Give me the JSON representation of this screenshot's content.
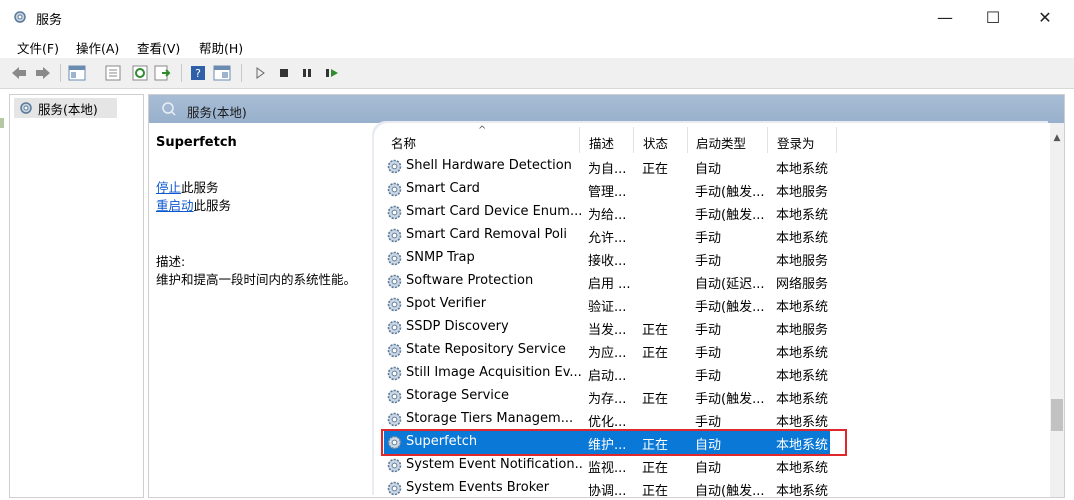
{
  "window": {
    "title": "服务",
    "icon": "services-gear-icon",
    "controls": {
      "minimize": "—",
      "maximize": "☐",
      "close": "✕"
    }
  },
  "menu": [
    "文件(F)",
    "操作(A)",
    "查看(V)",
    "帮助(H)"
  ],
  "toolbar": {
    "icons": [
      "back-icon",
      "forward-icon",
      "show-console-tree-icon",
      "properties-icon",
      "refresh-icon",
      "export-list-icon",
      "help-icon",
      "view-icon",
      "start-service-icon",
      "stop-service-icon",
      "pause-service-icon",
      "restart-service-icon"
    ]
  },
  "tree": {
    "root_label": "服务(本地)"
  },
  "pane": {
    "title": "服务(本地)",
    "selected_service": "Superfetch",
    "stop_link": "停止",
    "stop_suffix": "此服务",
    "restart_link": "重启动",
    "restart_suffix": "此服务",
    "desc_label": "描述:",
    "desc_text": "维护和提高一段时间内的系统性能。"
  },
  "table": {
    "columns": [
      "名称",
      "描述",
      "状态",
      "启动类型",
      "登录为"
    ],
    "rows": [
      {
        "name": "Shell Hardware Detection",
        "desc": "为自...",
        "status": "正在",
        "startup": "自动",
        "logon": "本地系统"
      },
      {
        "name": "Smart Card",
        "desc": "管理...",
        "status": "",
        "startup": "手动(触发...",
        "logon": "本地服务"
      },
      {
        "name": "Smart Card Device Enum...",
        "desc": "为给...",
        "status": "",
        "startup": "手动(触发...",
        "logon": "本地系统"
      },
      {
        "name": "Smart Card Removal Poli",
        "desc": "允许...",
        "status": "",
        "startup": "手动",
        "logon": "本地系统"
      },
      {
        "name": "SNMP Trap",
        "desc": "接收...",
        "status": "",
        "startup": "手动",
        "logon": "本地服务"
      },
      {
        "name": "Software Protection",
        "desc": "启用 ...",
        "status": "",
        "startup": "自动(延迟...",
        "logon": "网络服务"
      },
      {
        "name": "Spot Verifier",
        "desc": "验证...",
        "status": "",
        "startup": "手动(触发...",
        "logon": "本地系统"
      },
      {
        "name": "SSDP Discovery",
        "desc": "当发...",
        "status": "正在",
        "startup": "手动",
        "logon": "本地服务"
      },
      {
        "name": "State Repository Service",
        "desc": "为应...",
        "status": "正在",
        "startup": "手动",
        "logon": "本地系统"
      },
      {
        "name": "Still Image Acquisition Ev...",
        "desc": "启动...",
        "status": "",
        "startup": "手动",
        "logon": "本地系统"
      },
      {
        "name": "Storage Service",
        "desc": "为存...",
        "status": "正在",
        "startup": "手动(触发...",
        "logon": "本地系统"
      },
      {
        "name": "Storage Tiers Managem...",
        "desc": "优化...",
        "status": "",
        "startup": "手动",
        "logon": "本地系统"
      },
      {
        "name": "Superfetch",
        "desc": "维护...",
        "status": "正在",
        "startup": "自动",
        "logon": "本地系统"
      },
      {
        "name": "System Event Notification...",
        "desc": "监视...",
        "status": "正在",
        "startup": "自动",
        "logon": "本地系统"
      },
      {
        "name": "System Events Broker",
        "desc": "协调...",
        "status": "正在",
        "startup": "自动(触发...",
        "logon": "本地系统"
      }
    ],
    "selected_index": 12
  },
  "colors": {
    "selection": "#0a78d7",
    "highlight_border": "#e0282c",
    "header": "#a8bdd5",
    "link": "#0b57d0"
  }
}
